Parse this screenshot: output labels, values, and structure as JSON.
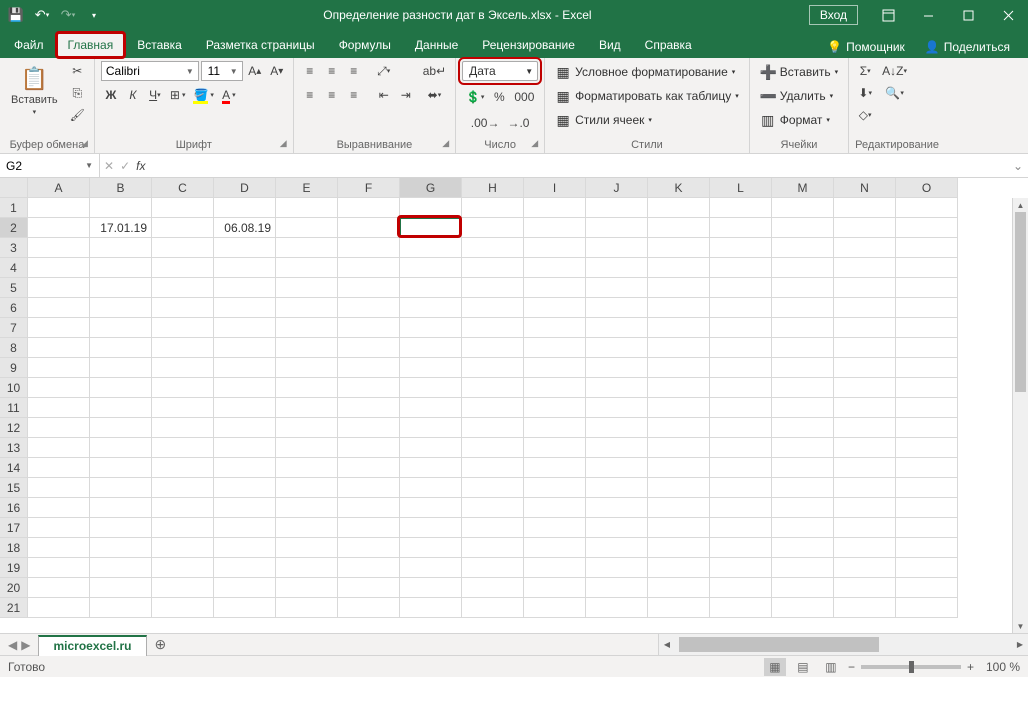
{
  "titlebar": {
    "title": "Определение разности дат в Эксель.xlsx  -  Excel",
    "login": "Вход"
  },
  "tabs": {
    "file": "Файл",
    "home": "Главная",
    "insert": "Вставка",
    "pagelayout": "Разметка страницы",
    "formulas": "Формулы",
    "data": "Данные",
    "review": "Рецензирование",
    "view": "Вид",
    "help": "Справка",
    "tellme": "Помощник",
    "share": "Поделиться"
  },
  "ribbon": {
    "clipboard": {
      "label": "Буфер обмена",
      "paste": "Вставить"
    },
    "font": {
      "label": "Шрифт",
      "name": "Calibri",
      "size": "11"
    },
    "alignment": {
      "label": "Выравнивание"
    },
    "number": {
      "label": "Число",
      "format": "Дата"
    },
    "styles": {
      "label": "Стили",
      "condfmt": "Условное форматирование",
      "fmt_table": "Форматировать как таблицу",
      "cell_styles": "Стили ячеек"
    },
    "cells": {
      "label": "Ячейки",
      "insert": "Вставить",
      "delete": "Удалить",
      "format": "Формат"
    },
    "editing": {
      "label": "Редактирование"
    }
  },
  "namebox": "G2",
  "columns": [
    "A",
    "B",
    "C",
    "D",
    "E",
    "F",
    "G",
    "H",
    "I",
    "J",
    "K",
    "L",
    "M",
    "N",
    "O"
  ],
  "rows": [
    "1",
    "2",
    "3",
    "4",
    "5",
    "6",
    "7",
    "8",
    "9",
    "10",
    "11",
    "12",
    "13",
    "14",
    "15",
    "16",
    "17",
    "18",
    "19",
    "20",
    "21"
  ],
  "cells": {
    "B2": "17.01.19",
    "D2": "06.08.19"
  },
  "active_cell": {
    "col_idx": 6,
    "row_idx": 1
  },
  "sheet": {
    "name": "microexcel.ru"
  },
  "status": {
    "ready": "Готово",
    "zoom": "100 %"
  }
}
